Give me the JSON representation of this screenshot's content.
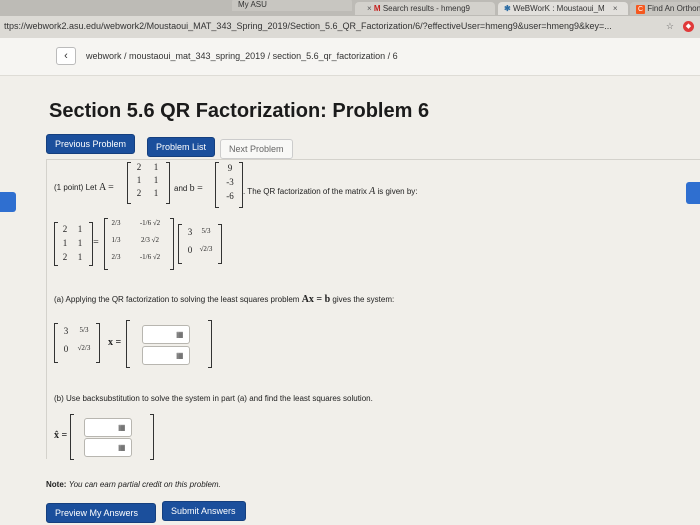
{
  "browser": {
    "tabs": [
      {
        "label": "My ASU"
      },
      {
        "label": "Search results - hmeng9"
      },
      {
        "label": "WeBWorK : Moustaoui_M"
      },
      {
        "label": "Find An Orthon"
      }
    ],
    "url": "ttps://webwork2.asu.edu/webwork2/Moustaoui_MAT_343_Spring_2019/Section_5.6_QR_Factorization/6/?effectiveUser=hmeng9&user=hmeng9&key=..."
  },
  "page": {
    "breadcrumb": "webwork / moustaoui_mat_343_spring_2019 / section_5.6_qr_factorization / 6",
    "title": "Section 5.6 QR Factorization: Problem 6",
    "buttons": {
      "previous": "Previous Problem",
      "list": "Problem List",
      "next": "Next Problem",
      "preview": "Preview My Answers",
      "submit": "Submit Answers"
    },
    "problem": {
      "points": "(1 point) Let",
      "matrix_A_label": "A =",
      "and_b": "and",
      "b_label": "b =",
      "intro_tail": ". The QR factorization of the matrix",
      "intro_tail2": "is given by:",
      "A": [
        [
          "2",
          "1"
        ],
        [
          "1",
          "1"
        ],
        [
          "2",
          "1"
        ]
      ],
      "b": [
        "9",
        "-3",
        "-6"
      ],
      "Q": [
        [
          "2/3",
          "-1/6 √2"
        ],
        [
          "1/3",
          "2/3 √2"
        ],
        [
          "2/3",
          "-1/6 √2"
        ]
      ],
      "R": [
        [
          "3",
          "5/3"
        ],
        [
          "0",
          "√2/3"
        ]
      ],
      "part_a": "(a) Applying the QR factorization to solving the least squares problem",
      "part_a_eq": "Ax = b",
      "part_a_tail": "gives the system:",
      "part_b": "(b) Use backsubstitution to solve the system in part (a) and find the least squares solution.",
      "xhat_label": "x̂ =",
      "x_label": "x =",
      "note_label": "Note:",
      "note_text": "You can earn partial credit on this problem."
    }
  }
}
